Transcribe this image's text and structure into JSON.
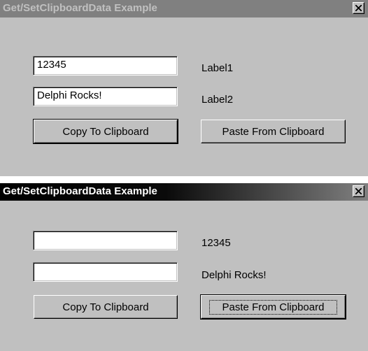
{
  "windows": [
    {
      "title": "Get/SetClipboardData Example",
      "title_state": "inactive",
      "close_icon": "close-icon",
      "edit1_value": "12345",
      "edit2_value": "Delphi Rocks!",
      "label1": "Label1",
      "label2": "Label2",
      "copy_button": "Copy To Clipboard",
      "paste_button": "Paste From Clipboard"
    },
    {
      "title": "Get/SetClipboardData Example",
      "title_state": "active",
      "close_icon": "close-icon",
      "edit1_value": "",
      "edit2_value": "",
      "label1": "12345",
      "label2": "Delphi Rocks!",
      "copy_button": "Copy To Clipboard",
      "paste_button": "Paste From Clipboard"
    }
  ],
  "colors": {
    "face": "#c0c0c0",
    "inactive_title": "#808080",
    "active_title": "#000000"
  }
}
